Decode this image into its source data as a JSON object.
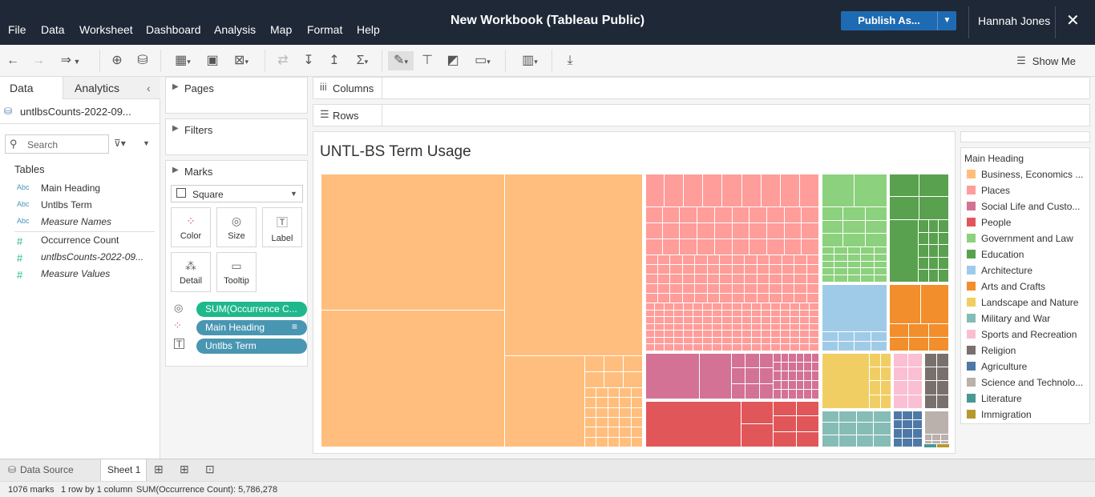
{
  "menu": [
    "File",
    "Data",
    "Worksheet",
    "Dashboard",
    "Analysis",
    "Map",
    "Format",
    "Help"
  ],
  "window_title": "New Workbook (Tableau Public)",
  "publish_label": "Publish As...",
  "user_name": "Hannah Jones",
  "show_me_label": "Show Me",
  "left_panel": {
    "tab_data": "Data",
    "tab_analytics": "Analytics",
    "datasource": "untlbsCounts-2022-09...",
    "search_placeholder": "Search",
    "tables_heading": "Tables",
    "fields": [
      {
        "type": "Abc",
        "name": "Main Heading",
        "italic": false
      },
      {
        "type": "Abc",
        "name": "Untlbs Term",
        "italic": false
      },
      {
        "type": "Abc",
        "name": "Measure Names",
        "italic": true
      },
      {
        "type": "#",
        "name": "Occurrence Count",
        "italic": false
      },
      {
        "type": "#",
        "name": "untlbsCounts-2022-09...",
        "italic": true
      },
      {
        "type": "#",
        "name": "Measure Values",
        "italic": true
      }
    ]
  },
  "cards": {
    "pages": "Pages",
    "filters": "Filters",
    "marks": "Marks",
    "mark_type": "Square",
    "buttons": [
      "Color",
      "Size",
      "Label",
      "Detail",
      "Tooltip"
    ],
    "pills": [
      {
        "label": "SUM(Occurrence C...",
        "color": "#1eb88c"
      },
      {
        "label": "Main Heading",
        "color": "#4996b2"
      },
      {
        "label": "Untlbs Term",
        "color": "#4996b2"
      }
    ]
  },
  "shelves": {
    "columns": "Columns",
    "rows": "Rows"
  },
  "viz_title": "UNTL-BS Term Usage",
  "legend": {
    "title": "Main Heading",
    "items": [
      {
        "label": "Business, Economics ...",
        "color": "#ffbe7d"
      },
      {
        "label": "Places",
        "color": "#ff9d9a"
      },
      {
        "label": "Social Life and Custo...",
        "color": "#d37295"
      },
      {
        "label": "People",
        "color": "#e15759"
      },
      {
        "label": "Government and Law",
        "color": "#8cd17d"
      },
      {
        "label": "Education",
        "color": "#59a14f"
      },
      {
        "label": "Architecture",
        "color": "#a0cbe8"
      },
      {
        "label": "Arts and Crafts",
        "color": "#f28e2b"
      },
      {
        "label": "Landscape and Nature",
        "color": "#f1ce63"
      },
      {
        "label": "Military and War",
        "color": "#86bcb6"
      },
      {
        "label": "Sports and Recreation",
        "color": "#fabfd2"
      },
      {
        "label": "Religion",
        "color": "#79706e"
      },
      {
        "label": "Agriculture",
        "color": "#4e79a7"
      },
      {
        "label": "Science and Technolo...",
        "color": "#bab0ac"
      },
      {
        "label": "Literature",
        "color": "#499894"
      },
      {
        "label": "Immigration",
        "color": "#b6992d"
      }
    ]
  },
  "bottom": {
    "data_source": "Data Source",
    "sheet": "Sheet 1"
  },
  "status": {
    "marks": "1076 marks",
    "dims": "1 row by 1 column",
    "sum": "SUM(Occurrence Count): 5,786,278"
  }
}
